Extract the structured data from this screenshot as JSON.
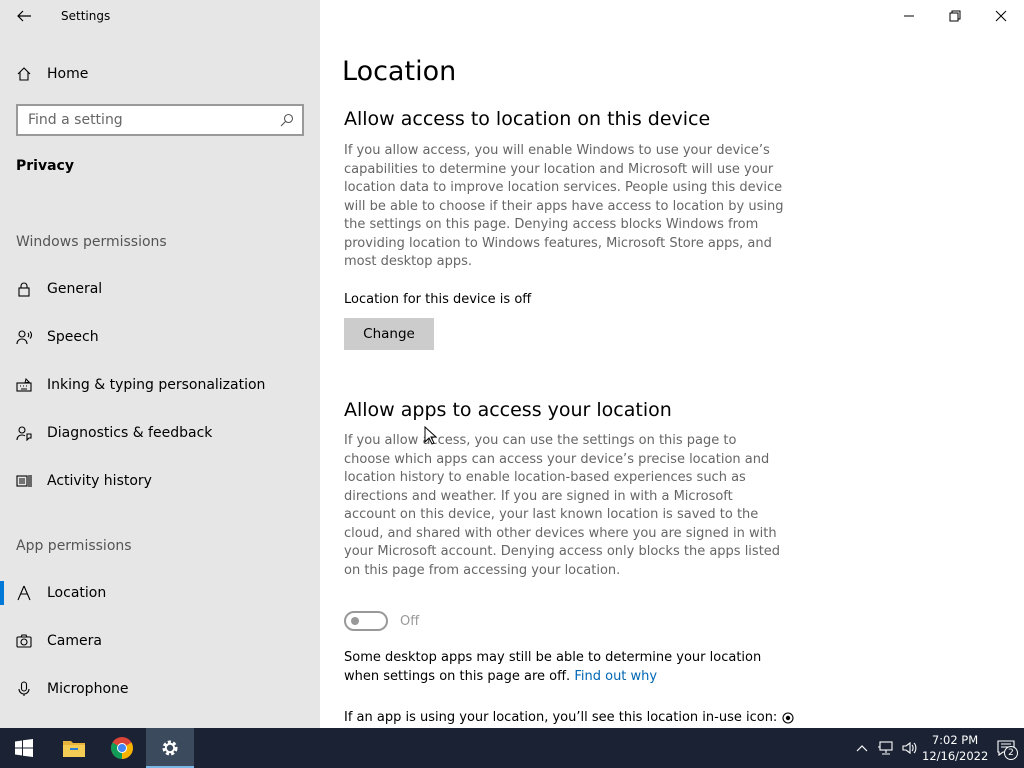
{
  "window": {
    "title": "Settings"
  },
  "sidebar": {
    "home_label": "Home",
    "search_placeholder": "Find a setting",
    "section": "Privacy",
    "groups": [
      {
        "title": "Windows permissions",
        "items": [
          {
            "label": "General",
            "icon": "lock-icon"
          },
          {
            "label": "Speech",
            "icon": "speech-icon"
          },
          {
            "label": "Inking & typing personalization",
            "icon": "inking-icon"
          },
          {
            "label": "Diagnostics & feedback",
            "icon": "diagnostics-icon"
          },
          {
            "label": "Activity history",
            "icon": "activity-history-icon"
          }
        ]
      },
      {
        "title": "App permissions",
        "items": [
          {
            "label": "Location",
            "icon": "location-icon",
            "active": true
          },
          {
            "label": "Camera",
            "icon": "camera-icon"
          },
          {
            "label": "Microphone",
            "icon": "microphone-icon"
          }
        ]
      }
    ]
  },
  "main": {
    "title": "Location",
    "section1": {
      "heading": "Allow access to location on this device",
      "description": "If you allow access, you will enable Windows to use your device’s capabilities to determine your location and Microsoft will use your location data to improve location services. People using this device will be able to choose if their apps have access to location by using the settings on this page. Denying access blocks Windows from providing location to Windows features, Microsoft Store apps, and most desktop apps.",
      "status": "Location for this device is off",
      "button": "Change"
    },
    "section2": {
      "heading": "Allow apps to access your location",
      "description": "If you allow access, you can use the settings on this page to choose which apps can access your device’s precise location and location history to enable location-based experiences such as directions and weather. If you are signed in with a Microsoft account on this device, your last known location is saved to the cloud, and shared with other devices where you are signed in with your Microsoft account. Denying access only blocks the apps listed on this page from accessing your location.",
      "toggle_label": "Off",
      "toggle_on": false,
      "note": "Some desktop apps may still be able to determine your location when settings on this page are off.",
      "note_link": "Find out why",
      "inuse_text": "If an app is using your location, you’ll see this location in-use icon:"
    }
  },
  "taskbar": {
    "time": "7:02 PM",
    "date": "12/16/2022",
    "notification_count": "2"
  },
  "colors": {
    "accent": "#0078d7",
    "link": "#0066b4",
    "sidebar_bg": "#e6e6e6",
    "taskbar_bg": "#1a2233"
  }
}
